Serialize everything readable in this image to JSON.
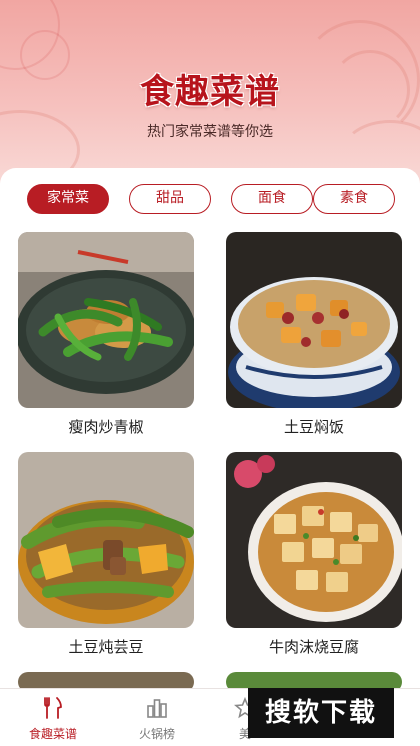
{
  "header": {
    "title": "食趣菜谱",
    "subtitle": "热门家常菜谱等你选"
  },
  "categories": [
    {
      "label": "家常菜",
      "active": true
    },
    {
      "label": "甜品",
      "active": false
    },
    {
      "label": "面食",
      "active": false
    },
    {
      "label": "素食",
      "active": false
    }
  ],
  "recipes": [
    {
      "name": "瘦肉炒青椒"
    },
    {
      "name": "土豆焖饭"
    },
    {
      "name": "土豆炖芸豆"
    },
    {
      "name": "牛肉沫烧豆腐"
    }
  ],
  "tabbar": {
    "items": [
      {
        "label": "食趣菜谱",
        "icon": "cutlery-icon",
        "active": true
      },
      {
        "label": "火锅榜",
        "icon": "bar-chart-icon",
        "active": false
      },
      {
        "label": "美",
        "icon": "star-icon",
        "active": false
      }
    ]
  },
  "watermark": {
    "text": "搜软下载"
  },
  "colors": {
    "accent": "#b81d24",
    "header_bg": "#f1a6a2"
  }
}
